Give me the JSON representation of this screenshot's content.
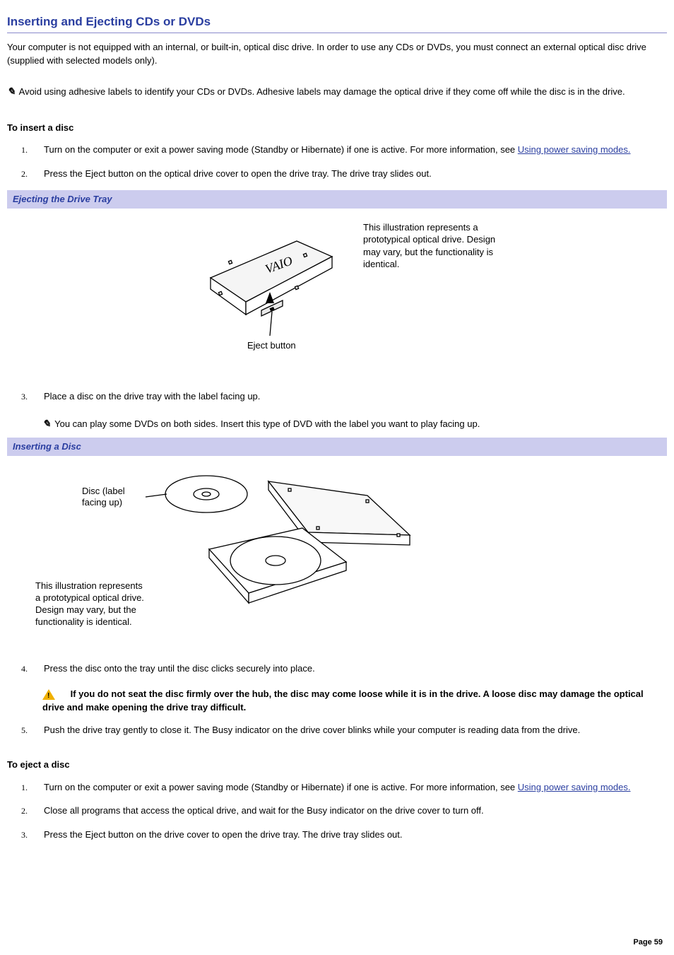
{
  "title": "Inserting and Ejecting CDs or DVDs",
  "intro": "Your computer is not equipped with an internal, or built-in, optical disc drive. In order to use any CDs or DVDs, you must connect an external optical disc drive (supplied with selected models only).",
  "note1": "Avoid using adhesive labels to identify your CDs or DVDs. Adhesive labels may damage the optical drive if they come off while the disc is in the drive.",
  "insert_heading": "To insert a disc",
  "insert_steps": {
    "s1_prefix": "Turn on the computer or exit a power saving mode (Standby or Hibernate) if one is active. For more information, see ",
    "s1_link": "Using power saving modes.",
    "s2": "Press the Eject button on the optical drive cover to open the drive tray. The drive tray slides out.",
    "s3": "Place a disc on the drive tray with the label facing up.",
    "s4": "Press the disc onto the tray until the disc clicks securely into place.",
    "s5": "Push the drive tray gently to close it. The Busy indicator on the drive cover blinks while your computer is reading data from the drive."
  },
  "caption1": "Ejecting the Drive Tray",
  "fig1_side_text": "This illustration represents a prototypical optical drive. Design may vary, but the functionality is identical.",
  "fig1_label_eject": "Eject button",
  "note2": "You can play some DVDs on both sides. Insert this type of DVD with the label you want to play facing up.",
  "caption2": "Inserting a Disc",
  "fig2_label_disc": "Disc (label",
  "fig2_label_disc2": "facing up)",
  "fig2_side_text_l1": "This illustration represents",
  "fig2_side_text_l2": "a prototypical optical drive.",
  "fig2_side_text_l3": "Design may vary, but the",
  "fig2_side_text_l4": "functionality is identical.",
  "warning": "If you do not seat the disc firmly over the hub, the disc may come loose while it is in the drive. A loose disc may damage the optical drive and make opening the drive tray difficult.",
  "eject_heading": "To eject a disc",
  "eject_steps": {
    "s1_prefix": "Turn on the computer or exit a power saving mode (Standby or Hibernate) if one is active. For more information, see ",
    "s1_link": "Using power saving modes.",
    "s2": "Close all programs that access the optical drive, and wait for the Busy indicator on the drive cover to turn off.",
    "s3": "Press the Eject button on the drive cover to open the drive tray. The drive tray slides out."
  },
  "page_number": "Page 59",
  "note_glyph": "✎"
}
